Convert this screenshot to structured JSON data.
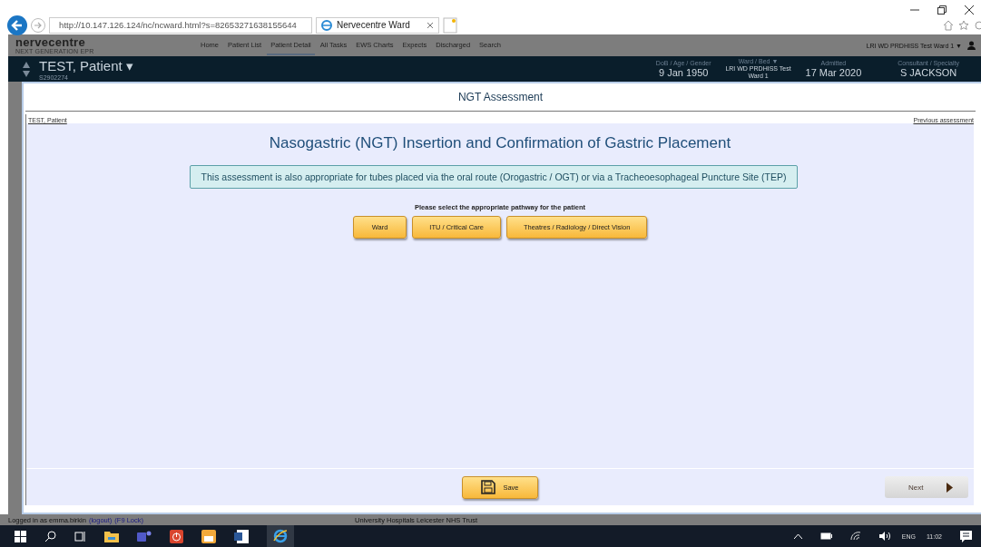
{
  "browser": {
    "address": "http://10.147.126.124/nc/ncward.html?s=82653271638155644",
    "tab_title": "Nervecentre Ward"
  },
  "app": {
    "logo": "nervecentre",
    "tagline": "NEXT GENERATION EPR",
    "nav": [
      {
        "label": "Home",
        "selected": false
      },
      {
        "label": "Patient List",
        "selected": false
      },
      {
        "label": "Patient Detail",
        "selected": true
      },
      {
        "label": "All Tasks",
        "selected": false
      },
      {
        "label": "EWS Charts",
        "selected": false
      },
      {
        "label": "Expects",
        "selected": false
      },
      {
        "label": "Discharged",
        "selected": false
      },
      {
        "label": "Search",
        "selected": false
      }
    ],
    "ward_menu": "LRI WD PRDHISS Test Ward 1 ▼"
  },
  "patient": {
    "name": "TEST, Patient",
    "menu_caret": "▾",
    "number": "S2902274",
    "fields": [
      {
        "label": "DoB / Age / Gender",
        "value": "9 Jan 1950"
      },
      {
        "label": "Ward / Bed ▼",
        "value": "LRI WD PRDHISS Test Ward 1"
      },
      {
        "label": "Admitted",
        "value": "17 Mar 2020"
      },
      {
        "label": "Consultant / Specialty",
        "value": "S JACKSON"
      }
    ]
  },
  "dialog": {
    "title": "NGT Assessment",
    "patient_link": "TEST, Patient",
    "previous_link": "Previous assessment",
    "heading": "Nasogastric (NGT) Insertion and Confirmation of Gastric Placement",
    "notice": "This assessment is also appropriate for tubes placed via the oral route (Orogastric / OGT) or via a Tracheoesophageal Puncture Site (TEP)",
    "prompt": "Please select the appropriate pathway for the patient",
    "pathways": [
      "Ward",
      "ITU / Critical Care",
      "Theatres / Radiology / Direct Vision"
    ],
    "save": "Save",
    "next": "Next"
  },
  "status_bar": {
    "login": "Logged in as emma.birkin",
    "logout": "(logout)",
    "lock": "(F9 Lock)",
    "trust": "University Hospitals Leicester NHS Trust"
  },
  "taskbar": {
    "language": "ENG",
    "time": "11:02"
  }
}
